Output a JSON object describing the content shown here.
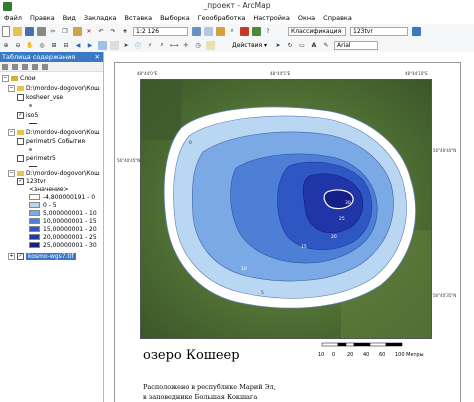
{
  "window": {
    "title": "_проект - ArcMap"
  },
  "menu": [
    "Файл",
    "Правка",
    "Вид",
    "Закладка",
    "Вставка",
    "Выборка",
    "Геообработка",
    "Настройка",
    "Окна",
    "Справка"
  ],
  "toolbar": {
    "scale": "1:2 126",
    "classification": "Классификация",
    "layer_combo": "123tvr",
    "actions": "Действия",
    "font": "Arial"
  },
  "toc": {
    "title": "Таблица содержания",
    "layers_root": "Слои",
    "groups": [
      {
        "path": "D:\\mordov-dogovor\\Кош",
        "layer": "kosheer_vse"
      },
      {
        "layer": "iso5"
      },
      {
        "path": "D:\\mordov-dogovor\\Кош",
        "layer": "perimetr5 События"
      },
      {
        "layer": "perimetr5"
      },
      {
        "path": "D:\\mordov-dogovor\\Кош",
        "layer": "123tvr"
      }
    ],
    "legend_header": "<значение>",
    "legend": [
      {
        "label": "-4,800000191 - 0",
        "color": "#ffffff"
      },
      {
        "label": "0 - 5",
        "color": "#b9d6f2"
      },
      {
        "label": "5,000000001 - 10",
        "color": "#7aa9e6"
      },
      {
        "label": "10,00000001 - 15",
        "color": "#4d7fd6"
      },
      {
        "label": "15,00000001 - 20",
        "color": "#2f57c4"
      },
      {
        "label": "20,00000001 - 25",
        "color": "#2035a8"
      },
      {
        "label": "25,00000001 - 30",
        "color": "#151f86"
      }
    ],
    "raster": "kosmo-wgs7.tif"
  },
  "map": {
    "title": "озеро Кошеер",
    "desc1": "Расположено в республике Марий Эл,",
    "desc2": "в заповеднике Большая Кокшага",
    "scale_labels": [
      "0",
      "10",
      "20",
      "40",
      "60",
      "80",
      "100 Метры"
    ],
    "grid_top": [
      "48°44'0\"E",
      "48°44'5\"E",
      "48°44'10\"E"
    ],
    "grid_side": [
      "56°40'45\"N",
      "56°40'40\"N",
      "56°40'35\"N"
    ],
    "contour_labels": [
      "0",
      "5",
      "10",
      "15",
      "20",
      "25",
      "30"
    ]
  }
}
